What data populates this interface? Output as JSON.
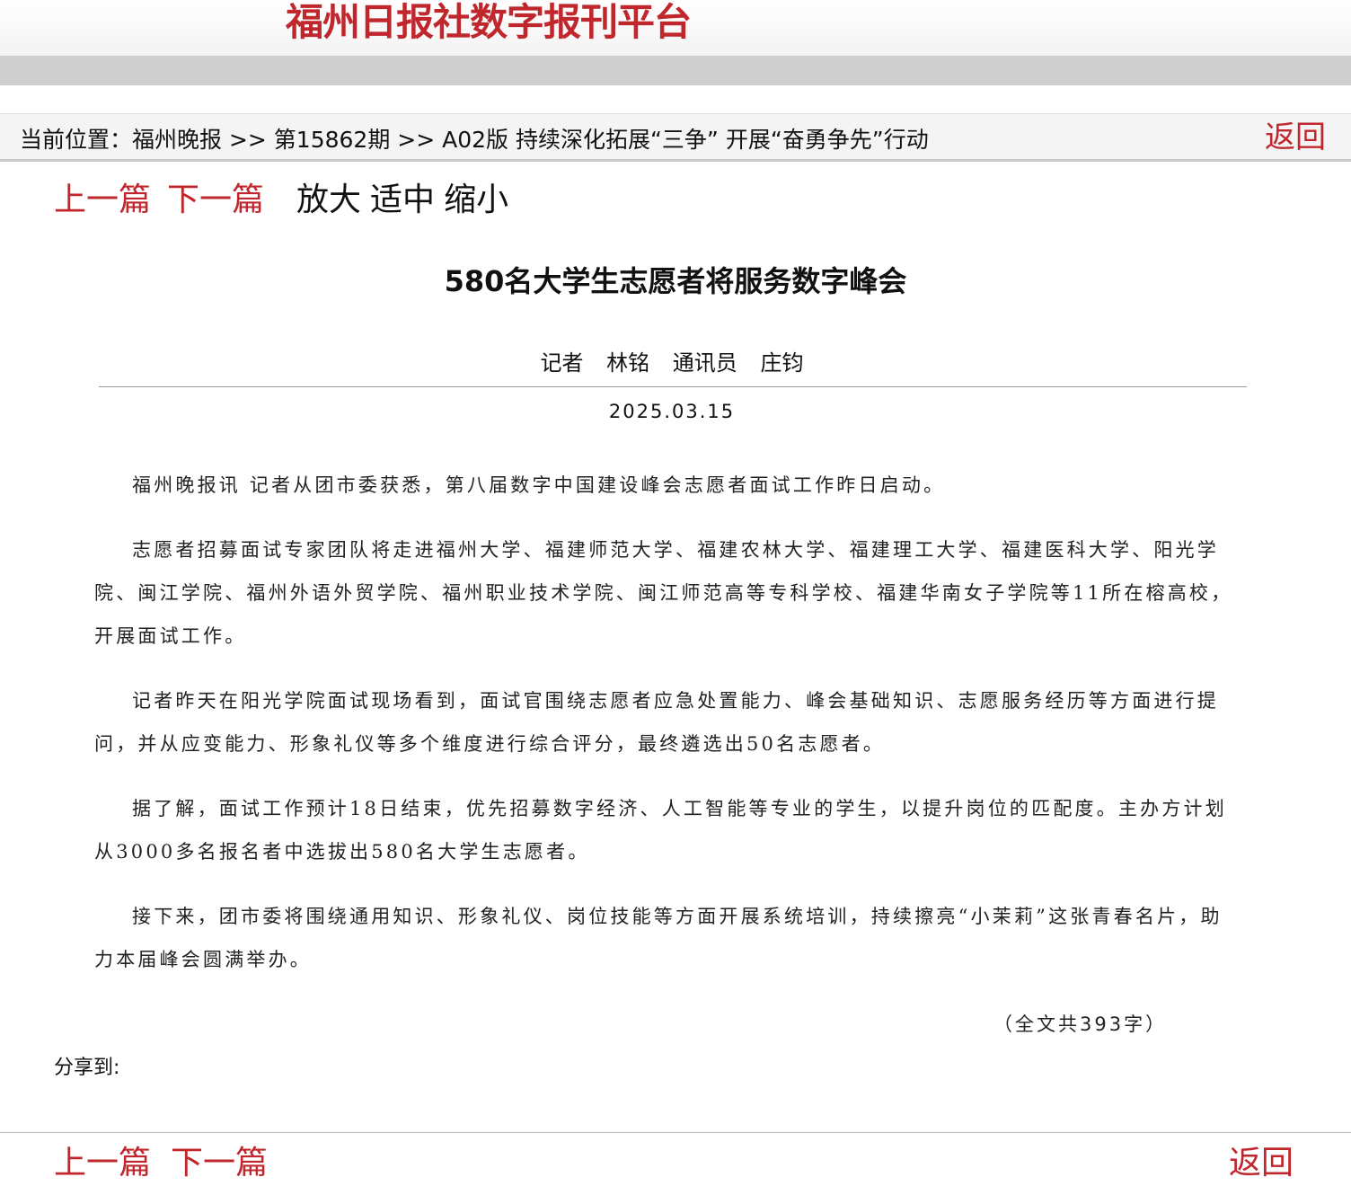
{
  "header": {
    "logo_text": "福州日报社数字报刊平台"
  },
  "breadcrumb": {
    "text": "当前位置：福州晚报 >> 第15862期 >> A02版 持续深化拓展“三争” 开展“奋勇争先”行动",
    "back_label": "返回"
  },
  "toolbar": {
    "prev_label": "上一篇",
    "next_label": "下一篇",
    "zoom_in_label": "放大",
    "zoom_fit_label": "适中",
    "zoom_out_label": "缩小"
  },
  "article": {
    "title": "580名大学生志愿者将服务数字峰会",
    "byline": "记者 林铭 通讯员 庄钧",
    "date": "2025.03.15",
    "paragraphs": [
      "福州晚报讯 记者从团市委获悉，第八届数字中国建设峰会志愿者面试工作昨日启动。",
      "志愿者招募面试专家团队将走进福州大学、福建师范大学、福建农林大学、福建理工大学、福建医科大学、阳光学院、闽江学院、福州外语外贸学院、福州职业技术学院、闽江师范高等专科学校、福建华南女子学院等11所在榕高校，开展面试工作。",
      "记者昨天在阳光学院面试现场看到，面试官围绕志愿者应急处置能力、峰会基础知识、志愿服务经历等方面进行提问，并从应变能力、形象礼仪等多个维度进行综合评分，最终遴选出50名志愿者。",
      "据了解，面试工作预计18日结束，优先招募数字经济、人工智能等专业的学生，以提升岗位的匹配度。主办方计划从3000多名报名者中选拔出580名大学生志愿者。",
      "接下来，团市委将围绕通用知识、形象礼仪、岗位技能等方面开展系统培训，持续擦亮“小茉莉”这张青春名片，助力本届峰会圆满举办。"
    ],
    "word_count": "（全文共393字）"
  },
  "share": {
    "label": "分享到:"
  },
  "footer": {
    "prev_label": "上一篇",
    "next_label": "下一篇",
    "back_label": "返回"
  },
  "colors": {
    "accent_red": "#c0272d",
    "band_gray": "#cfcfcf"
  }
}
